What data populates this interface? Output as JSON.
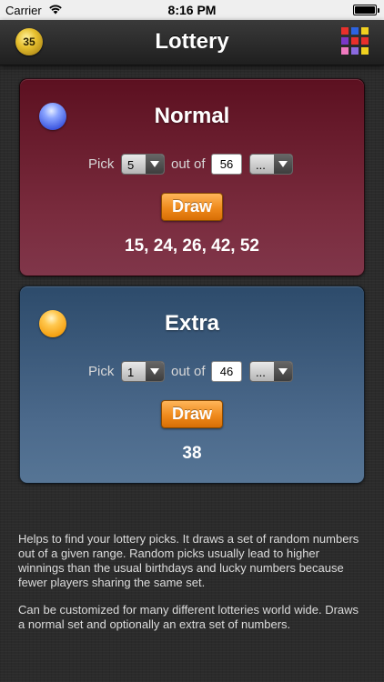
{
  "status_bar": {
    "carrier": "Carrier",
    "time": "8:16 PM"
  },
  "navbar": {
    "title": "Lottery",
    "badge": "35",
    "grid_colors": [
      "#e8302c",
      "#2d63e0",
      "#f0d020",
      "#7a38c8",
      "#e8302c",
      "#e8302c",
      "#f07ac0",
      "#8a6ae0",
      "#f0d020"
    ]
  },
  "normal": {
    "title": "Normal",
    "pick_label": "Pick",
    "pick_value": "5",
    "out_of_label": "out of",
    "out_of_value": "56",
    "more_value": "...",
    "draw_label": "Draw",
    "result": "15, 24, 26, 42, 52"
  },
  "extra": {
    "title": "Extra",
    "pick_label": "Pick",
    "pick_value": "1",
    "out_of_label": "out of",
    "out_of_value": "46",
    "more_value": "...",
    "draw_label": "Draw",
    "result": "38"
  },
  "description": {
    "paragraph_1": "Helps to find your lottery picks. It draws a set of random numbers out of a given range. Random picks usually lead to higher winnings than the usual birthdays and lucky numbers because fewer players sharing the same set.",
    "paragraph_2": "Can be customized for many different lotteries world wide. Draws a normal set and optionally an extra set of numbers."
  }
}
